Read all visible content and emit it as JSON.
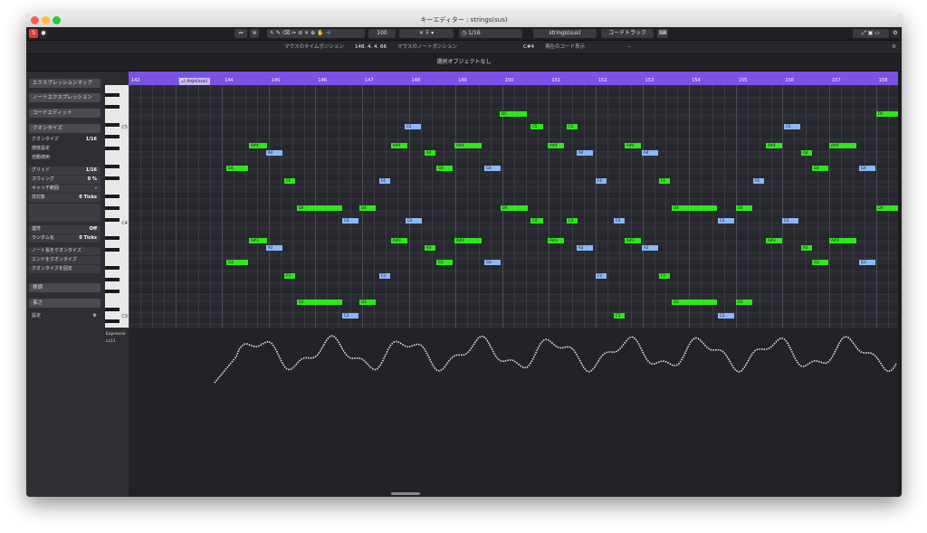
{
  "window": {
    "title": "キーエディター : strings(sus)"
  },
  "toolbar": {
    "quantize_value": "1/16",
    "velocity": "100",
    "track_name": "strings(sus)",
    "chord_track": "コードトラック"
  },
  "infobar": {
    "mouse_time_label": "マウスのタイムポジション",
    "mouse_time_value": "148. 4. 4. 66",
    "mouse_note_label": "マウスのノートポジション",
    "mouse_note_value": "C#4",
    "chord_label": "現在のコード表示",
    "chord_value": "--"
  },
  "status": {
    "text": "選択オブジェクトなし"
  },
  "inspector": {
    "expression_map": "エクスプレッションマップ",
    "note_expression": "ノートエクスプレッション",
    "chord_edit": "コードエディット",
    "quantize": "クオンタイズ",
    "quantize_row": "クオンタイズ",
    "quantize_row_val": "1/16",
    "sensitivity": "感度設定",
    "auto_apply": "自動適用",
    "grid": "グリッド",
    "grid_val": "1/16",
    "swing": "スウィング",
    "swing_val": "0 %",
    "catch": "キャッチ範囲",
    "catch_val": "-",
    "non_quant": "非対象",
    "non_quant_val": "0 Ticks",
    "tuplet": "連符",
    "tuplet_val": "Off",
    "random": "ランダム化",
    "random_val": "0 Ticks",
    "q_note_start": "ノート長をクオンタイズ",
    "q_end": "エンドをクオンタイズ",
    "q_fix": "クオンタイズを固定",
    "transpose": "移調",
    "length": "長さ",
    "settings": "設定"
  },
  "keys": {
    "c5": "C5",
    "c4": "C4",
    "c3": "C3"
  },
  "ruler": {
    "part_name": "strings(sus)",
    "bars": [
      "142",
      "143",
      "144",
      "145",
      "146",
      "147",
      "148",
      "149",
      "150",
      "151",
      "152",
      "153",
      "154",
      "155",
      "156",
      "157",
      "158"
    ]
  },
  "notes": [
    {
      "label": "D5",
      "c": "g"
    },
    {
      "label": "C5",
      "c": "b"
    },
    {
      "label": "C5",
      "c": "g"
    },
    {
      "label": "C5",
      "c": "g"
    },
    {
      "label": "C5",
      "c": "b"
    },
    {
      "label": "D5",
      "c": "g"
    },
    {
      "label": "A#4",
      "c": "g"
    },
    {
      "label": "A4",
      "c": "b"
    },
    {
      "label": "A#4",
      "c": "g"
    },
    {
      "label": "A4",
      "c": "g"
    },
    {
      "label": "A#4",
      "c": "g"
    },
    {
      "label": "A#4",
      "c": "g"
    },
    {
      "label": "A4",
      "c": "b"
    },
    {
      "label": "A#4",
      "c": "g"
    },
    {
      "label": "A4",
      "c": "b"
    },
    {
      "label": "A#4",
      "c": "g"
    },
    {
      "label": "A4",
      "c": "g"
    },
    {
      "label": "A#4",
      "c": "g"
    },
    {
      "label": "G4",
      "c": "g"
    },
    {
      "label": "G4",
      "c": "g"
    },
    {
      "label": "G4",
      "c": "b"
    },
    {
      "label": "G4",
      "c": "g"
    },
    {
      "label": "G4",
      "c": "b"
    },
    {
      "label": "F4",
      "c": "g"
    },
    {
      "label": "F4",
      "c": "b"
    },
    {
      "label": "F4",
      "c": "b"
    },
    {
      "label": "F4",
      "c": "g"
    },
    {
      "label": "F4",
      "c": "b"
    },
    {
      "label": "F4",
      "c": "b"
    },
    {
      "label": "D4",
      "c": "g"
    },
    {
      "label": "D4",
      "c": "g"
    },
    {
      "label": "D4",
      "c": "g"
    },
    {
      "label": "D4",
      "c": "g"
    },
    {
      "label": "D4",
      "c": "g"
    },
    {
      "label": "D4",
      "c": "g"
    },
    {
      "label": "C4",
      "c": "b"
    },
    {
      "label": "C4",
      "c": "b"
    },
    {
      "label": "C4",
      "c": "g"
    },
    {
      "label": "C4",
      "c": "g"
    },
    {
      "label": "C4",
      "c": "b"
    },
    {
      "label": "C4",
      "c": "b"
    },
    {
      "label": "C4",
      "c": "b"
    },
    {
      "label": "A#3",
      "c": "g"
    },
    {
      "label": "A3",
      "c": "b"
    },
    {
      "label": "A#3",
      "c": "g"
    },
    {
      "label": "A3",
      "c": "g"
    },
    {
      "label": "A#3",
      "c": "g"
    },
    {
      "label": "A#3",
      "c": "g"
    },
    {
      "label": "A3",
      "c": "b"
    },
    {
      "label": "A#3",
      "c": "g"
    },
    {
      "label": "A3",
      "c": "b"
    },
    {
      "label": "A#3",
      "c": "g"
    },
    {
      "label": "A3",
      "c": "g"
    },
    {
      "label": "A#3",
      "c": "g"
    },
    {
      "label": "A3",
      "c": "b"
    },
    {
      "label": "G3",
      "c": "g"
    },
    {
      "label": "G3",
      "c": "g"
    },
    {
      "label": "G3",
      "c": "b"
    },
    {
      "label": "G3",
      "c": "g"
    },
    {
      "label": "G3",
      "c": "b"
    },
    {
      "label": "F3",
      "c": "g"
    },
    {
      "label": "F3",
      "c": "b"
    },
    {
      "label": "F3",
      "c": "b"
    },
    {
      "label": "F3",
      "c": "g"
    },
    {
      "label": "D3",
      "c": "g"
    },
    {
      "label": "D3",
      "c": "g"
    },
    {
      "label": "D3",
      "c": "g"
    },
    {
      "label": "D3",
      "c": "g"
    },
    {
      "label": "C3",
      "c": "b"
    },
    {
      "label": "C3",
      "c": "g"
    },
    {
      "label": "C3",
      "c": "b"
    }
  ],
  "controller": {
    "lane_name": "Expressio",
    "cc": "cc11"
  },
  "colors": {
    "ruler": "#7b52e6",
    "note_green": "#2ee81a",
    "note_blue": "#8ab8ff",
    "record": "#e23b2e"
  }
}
